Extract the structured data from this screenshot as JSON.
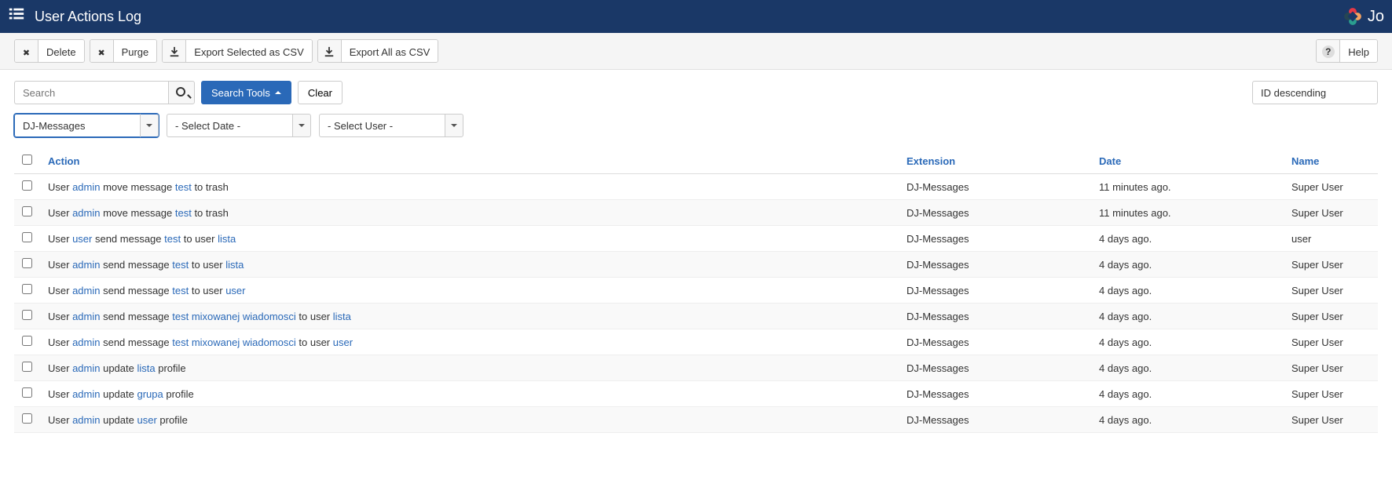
{
  "header": {
    "title": "User Actions Log",
    "brand": "Jo"
  },
  "toolbar": {
    "delete": "Delete",
    "purge": "Purge",
    "export_selected": "Export Selected as CSV",
    "export_all": "Export All as CSV",
    "help": "Help"
  },
  "search": {
    "placeholder": "Search",
    "tools": "Search Tools",
    "clear": "Clear",
    "sort": "ID descending"
  },
  "filters": {
    "extension": "DJ-Messages",
    "date": "- Select Date -",
    "user": "- Select User -"
  },
  "columns": {
    "action": "Action",
    "extension": "Extension",
    "date": "Date",
    "name": "Name"
  },
  "rows": [
    {
      "action_parts": [
        "User ",
        {
          "link": "admin"
        },
        " move message ",
        {
          "link": "test"
        },
        " to trash"
      ],
      "extension": "DJ-Messages",
      "date": "11 minutes ago.",
      "name": "Super User"
    },
    {
      "action_parts": [
        "User ",
        {
          "link": "admin"
        },
        " move message ",
        {
          "link": "test"
        },
        " to trash"
      ],
      "extension": "DJ-Messages",
      "date": "11 minutes ago.",
      "name": "Super User"
    },
    {
      "action_parts": [
        "User ",
        {
          "link": "user"
        },
        " send message ",
        {
          "link": "test"
        },
        " to user ",
        {
          "link": "lista"
        }
      ],
      "extension": "DJ-Messages",
      "date": "4 days ago.",
      "name": "user"
    },
    {
      "action_parts": [
        "User ",
        {
          "link": "admin"
        },
        " send message ",
        {
          "link": "test"
        },
        " to user ",
        {
          "link": "lista"
        }
      ],
      "extension": "DJ-Messages",
      "date": "4 days ago.",
      "name": "Super User"
    },
    {
      "action_parts": [
        "User ",
        {
          "link": "admin"
        },
        " send message ",
        {
          "link": "test"
        },
        " to user ",
        {
          "link": "user"
        }
      ],
      "extension": "DJ-Messages",
      "date": "4 days ago.",
      "name": "Super User"
    },
    {
      "action_parts": [
        "User ",
        {
          "link": "admin"
        },
        " send message ",
        {
          "link": "test mixowanej wiadomosci"
        },
        " to user ",
        {
          "link": "lista"
        }
      ],
      "extension": "DJ-Messages",
      "date": "4 days ago.",
      "name": "Super User"
    },
    {
      "action_parts": [
        "User ",
        {
          "link": "admin"
        },
        " send message ",
        {
          "link": "test mixowanej wiadomosci"
        },
        " to user ",
        {
          "link": "user"
        }
      ],
      "extension": "DJ-Messages",
      "date": "4 days ago.",
      "name": "Super User"
    },
    {
      "action_parts": [
        "User ",
        {
          "link": "admin"
        },
        " update ",
        {
          "link": "lista"
        },
        " profile"
      ],
      "extension": "DJ-Messages",
      "date": "4 days ago.",
      "name": "Super User"
    },
    {
      "action_parts": [
        "User ",
        {
          "link": "admin"
        },
        " update ",
        {
          "link": "grupa"
        },
        " profile"
      ],
      "extension": "DJ-Messages",
      "date": "4 days ago.",
      "name": "Super User"
    },
    {
      "action_parts": [
        "User ",
        {
          "link": "admin"
        },
        " update ",
        {
          "link": "user"
        },
        " profile"
      ],
      "extension": "DJ-Messages",
      "date": "4 days ago.",
      "name": "Super User"
    }
  ]
}
